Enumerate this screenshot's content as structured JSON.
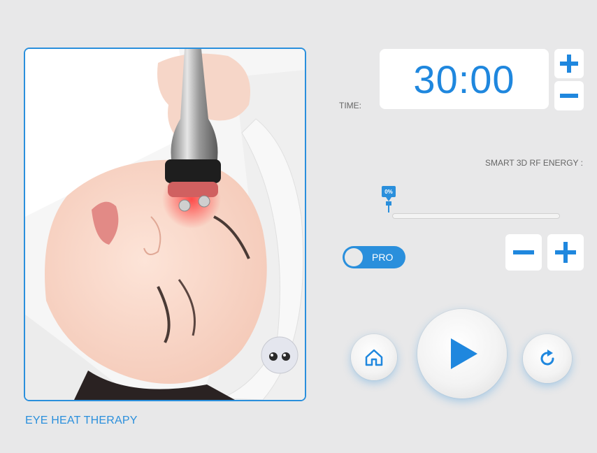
{
  "colors": {
    "accent": "#2a8fdc",
    "background": "#e8e8e9"
  },
  "therapy": {
    "caption": "EYE HEAT THERAPY"
  },
  "timer": {
    "label": "TIME:",
    "value": "30:00"
  },
  "energy": {
    "label": "SMART 3D RF ENERGY :",
    "percent_text": "0%",
    "level": 0
  },
  "mode": {
    "toggle_label": "PRO"
  },
  "icons": {
    "time_plus": "plus-icon",
    "time_minus": "minus-icon",
    "energy_minus": "minus-icon",
    "energy_plus": "plus-icon",
    "home": "home-icon",
    "play": "play-icon",
    "reset": "refresh-icon"
  }
}
